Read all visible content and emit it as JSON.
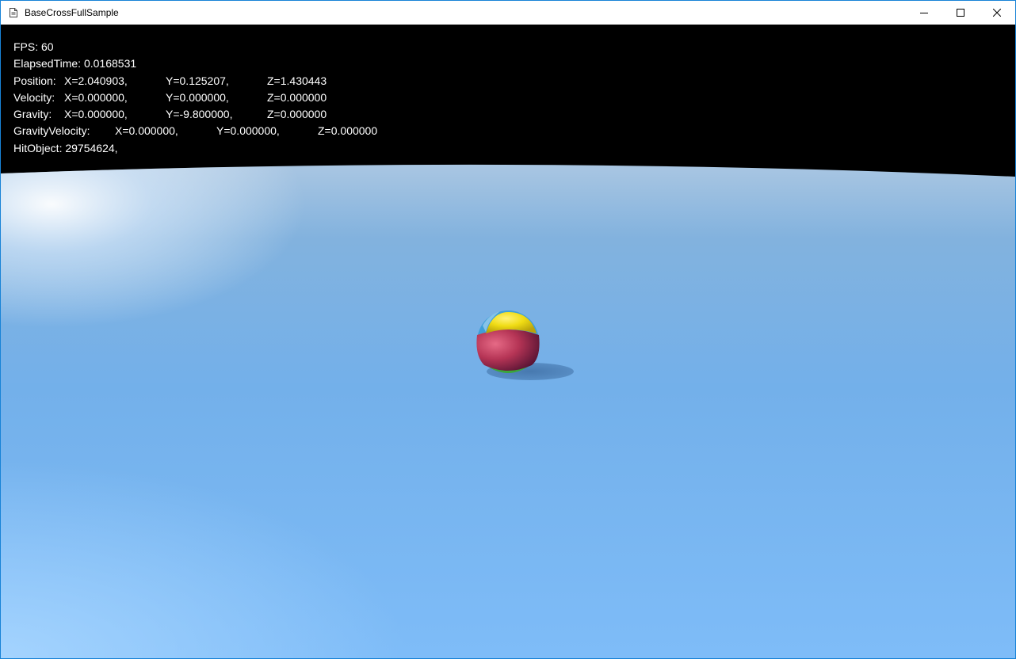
{
  "window": {
    "title": "BaseCrossFullSample",
    "app_icon": "document-icon",
    "controls": {
      "minimize_icon": "minimize-icon",
      "maximize_icon": "maximize-icon",
      "close_icon": "close-icon"
    }
  },
  "hud": {
    "fps": "FPS: 60",
    "elapsed": "ElapsedTime: 0.0168531",
    "position": {
      "label": "Position:",
      "x": "X=2.040903,",
      "y": "Y=0.125207,",
      "z": "Z=1.430443"
    },
    "velocity": {
      "label": "Velocity:",
      "x": "X=0.000000,",
      "y": "Y=0.000000,",
      "z": "Z=0.000000"
    },
    "gravity": {
      "label": "Gravity:",
      "x": "X=0.000000,",
      "y": "Y=-9.800000,",
      "z": "Z=0.000000"
    },
    "gravity_velocity": {
      "label": "GravityVelocity:",
      "x": "X=0.000000,",
      "y": "Y=0.000000,",
      "z": "Z=0.000000"
    },
    "hit_object": "HitObject: 29754624,"
  },
  "scene": {
    "background_color": "#000000",
    "ground_color": "#79b6ee",
    "ball_colors": [
      "#f2e21c",
      "#c23a58",
      "#3aa63a",
      "#3f9fd8"
    ]
  }
}
